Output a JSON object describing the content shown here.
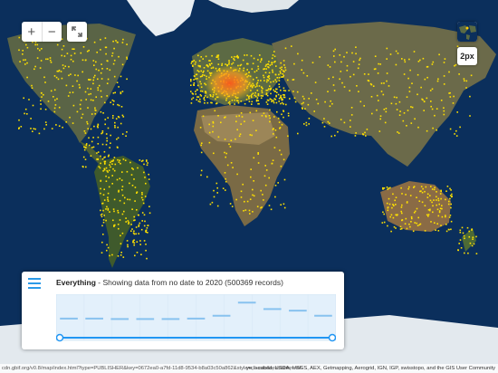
{
  "map": {
    "controls": {
      "zoom_in": "+",
      "zoom_out": "−",
      "pixel_size": "2px"
    },
    "colors": {
      "ocean": "#0b2f5c",
      "land": "#4a5a3a",
      "ice": "#e9eef2",
      "points": "#ffe100",
      "hotspot": "#ff7a1a"
    }
  },
  "panel": {
    "title_bold": "Everything",
    "title_rest": " - Showing data from no date to 2020 (500369 records)",
    "colors": {
      "fill": "#e3f0fb",
      "line": "#3399e6",
      "bar": "#88c2ef",
      "handle": "#2196f3"
    }
  },
  "chart_data": {
    "type": "line",
    "x": [
      1,
      2,
      3,
      4,
      5,
      6,
      7,
      8,
      9,
      10,
      11
    ],
    "values": [
      0.48,
      0.48,
      0.47,
      0.47,
      0.47,
      0.48,
      0.55,
      0.88,
      0.72,
      0.68,
      0.55
    ]
  },
  "attribution": {
    "url": "cdn.gbif.org/v0.8/map/index.html?type=PUBLISHER&key=0672ea0-a7fd-11d8-9534-b8a03c50a862&style=classic&resolution=##",
    "text": "ye, i-cubed, USDA, USGS, AEX, Getmapping, Aerogrid, IGN, IGP, swisstopo, and the GIS User Community"
  }
}
